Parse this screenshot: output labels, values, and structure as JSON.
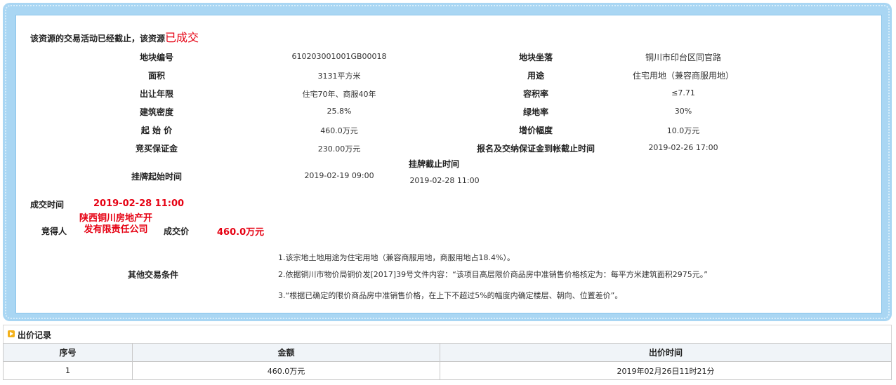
{
  "notice": {
    "text": "该资源的交易活动已经截止，该资源",
    "status": "已成交"
  },
  "fields": {
    "parcel_no_label": "地块编号",
    "parcel_no": "610203001001GB00018",
    "location_label": "地块坐落",
    "location": "铜川市印台区同官路",
    "area_label": "面积",
    "area": "3131平方米",
    "usage_label": "用途",
    "usage": "住宅用地（兼容商服用地）",
    "term_label": "出让年限",
    "term": "住宅70年、商服40年",
    "far_label": "容积率",
    "far": "≤7.71",
    "density_label": "建筑密度",
    "density": "25.8%",
    "green_label": "绿地率",
    "green": "30%",
    "start_price_label": "起 始 价",
    "start_price": "460.0万元",
    "increment_label": "增价幅度",
    "increment": "10.0万元",
    "deposit_label": "竞买保证金",
    "deposit": "230.00万元",
    "deposit_deadline_label": "报名及交纳保证金到帐截止时间",
    "deposit_deadline": "2019-02-26 17:00",
    "listing_start_label": "挂牌起始时间",
    "listing_start": "2019-02-19 09:00",
    "listing_end_label": "挂牌截止时间",
    "listing_end": "2019-02-28 11:00"
  },
  "result": {
    "deal_time_label": "成交时间",
    "deal_time": "2019-02-28 11:00",
    "winner_label": "竞得人",
    "winner": "陕西铜川房地产开发有限责任公司",
    "deal_price_label": "成交价",
    "deal_price": "460.0万元"
  },
  "other_conditions": {
    "label": "其他交易条件",
    "items": [
      "1.该宗地土地用途为住宅用地（兼容商服用地，商服用地占18.4%）。",
      "2.依据铜川市物价局铜价发[2017]39号文件内容：“该项目高层限价商品房中准销售价格核定为：每平方米建筑面积2975元。”",
      "3.“根据已确定的限价商品房中准销售价格，在上下不超过5%的幅度内确定楼层、朝向、位置差价”。"
    ]
  },
  "bid_records": {
    "title": "出价记录",
    "headers": [
      "序号",
      "金额",
      "出价时间"
    ],
    "rows": [
      [
        "1",
        "460.0万元",
        "2019年02月26日11时21分"
      ]
    ]
  },
  "colors": {
    "frame": "#a9d6f3",
    "accent_red": "#e60012",
    "icon": "#f3b11b"
  }
}
